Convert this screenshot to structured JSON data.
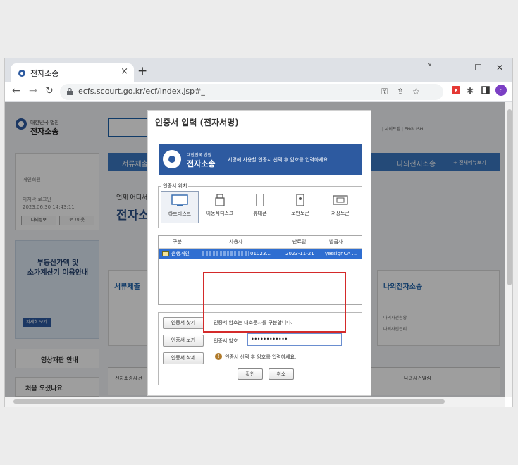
{
  "browser": {
    "tab_title": "전자소송",
    "new_tab": "+",
    "close_tab": "×",
    "url": "ecfs.scourt.go.kr/ecf/index.jsp#_",
    "window_controls": [
      "˅",
      "—",
      "☐",
      "✕"
    ]
  },
  "site": {
    "logo_small": "대한민국 법원",
    "logo_big": "전자소송",
    "top_links": "| 사이트맵 | ENGLISH",
    "nav": [
      "서류제출",
      "나의전자소송",
      "+ 전체메뉴보기"
    ],
    "login_label": "개인회원",
    "last_login_label": "마지막 로그인",
    "last_login_time": "2023.06.30 14:43:11",
    "my_info": "나의정보",
    "logout": "로그아웃",
    "banner_title_1": "부동산가액 및",
    "banner_title_2": "소가계산기 이용안내",
    "banner_button": "자세히 보기",
    "video_trial": "영상재판 안내",
    "first_visit": "처음 오셨나요",
    "hero_small": "언제 어디서",
    "hero_big": "전자소",
    "card_left_title": "서류제출",
    "card_right_title": "나의전자소송",
    "card_right_items": [
      "나의사건현황",
      "나의사건관리"
    ],
    "bottom_items": [
      "전자소송사건",
      "나의사건알림"
    ]
  },
  "dialog": {
    "title": "인증서 입력 (전자서명)",
    "banner_small": "대한민국 법원",
    "banner_big": "전자소송",
    "banner_message": "서명에 사용할 인증서 선택 후 암호를 입력하세요.",
    "location_legend": "인증서 위치",
    "locations": [
      "하드디스크",
      "이동식디스크",
      "휴대폰",
      "보안토큰",
      "저장토큰"
    ],
    "selected_location": "하드디스크",
    "table_headers": [
      "구분",
      "사용자",
      "만료일",
      "발급자"
    ],
    "cert_row": {
      "type": "은행개인",
      "user": "01023...",
      "expiry": "2023-11-21",
      "issuer": "yessignCA ..."
    },
    "find_button": "인증서 찾기",
    "view_button": "인증서 보기",
    "delete_button": "인증서 삭제",
    "case_hint": "인증서 암호는 대소문자를 구분합니다.",
    "password_label": "인증서 암호",
    "password_value": "••••••••••••",
    "warning": "인증서 선택 후 암호를 입력하세요.",
    "ok_button": "확인",
    "cancel_button": "취소"
  },
  "colors": {
    "highlight": "#d42a2a",
    "selected_row": "#2f6ed1",
    "banner": "#2d5aa0"
  }
}
